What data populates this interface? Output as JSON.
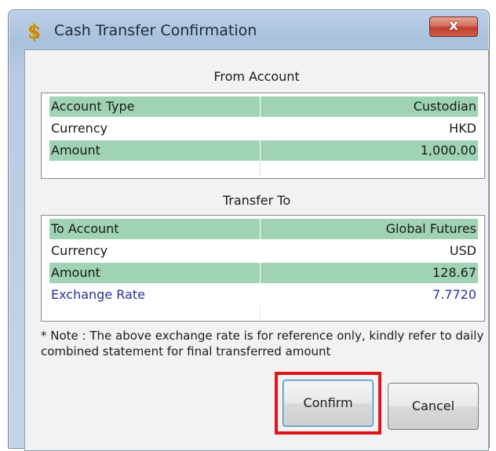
{
  "window": {
    "title": "Cash Transfer Confirmation",
    "icon": "dollar-coin-icon",
    "close_label": "x"
  },
  "from_account": {
    "heading": "From Account",
    "rows": [
      {
        "label": "Account Type",
        "value": "Custodian"
      },
      {
        "label": "Currency",
        "value": "HKD"
      },
      {
        "label": "Amount",
        "value": "1,000.00"
      }
    ]
  },
  "transfer_to": {
    "heading": "Transfer To",
    "rows": [
      {
        "label": "To Account",
        "value": "Global Futures"
      },
      {
        "label": "Currency",
        "value": "USD"
      },
      {
        "label": "Amount",
        "value": "128.67"
      },
      {
        "label": "Exchange Rate",
        "value": "7.7720"
      }
    ]
  },
  "note": "* Note : The above exchange rate is for reference only, kindly refer to daily combined statement for final transferred amount",
  "buttons": {
    "confirm": "Confirm",
    "cancel": "Cancel"
  },
  "colors": {
    "row_highlight": "#9fd3b3",
    "exchange_rate_text": "#2b2e9e",
    "annotation_box": "#e0141b"
  }
}
